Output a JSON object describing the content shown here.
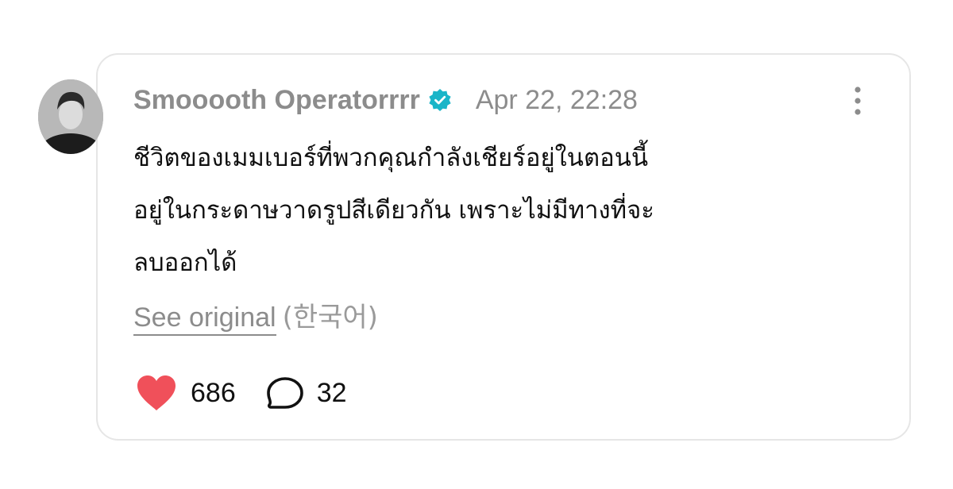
{
  "post": {
    "author": "Smooooth Operatorrrr",
    "verified_icon": "verified-badge-icon",
    "timestamp": "Apr 22, 22:28",
    "text": "ชีวิตของเมมเบอร์ที่พวกคุณกำลังเชียร์อยู่ในตอนนี้\nอยู่ในกระดาษวาดรูปสีเดียวกัน เพราะไม่มีทางที่จะ\nลบออกได้",
    "see_original_label": "See original",
    "original_language": "(한국어)",
    "likes_count": "686",
    "comments_count": "32"
  },
  "colors": {
    "verified": "#1ab5c8",
    "heart": "#f0505a",
    "muted_text": "#8c8c8c",
    "card_border": "#e6e6e6"
  },
  "icons": {
    "more": "more-vertical-icon",
    "like": "heart-icon",
    "comment": "comment-bubble-icon"
  }
}
